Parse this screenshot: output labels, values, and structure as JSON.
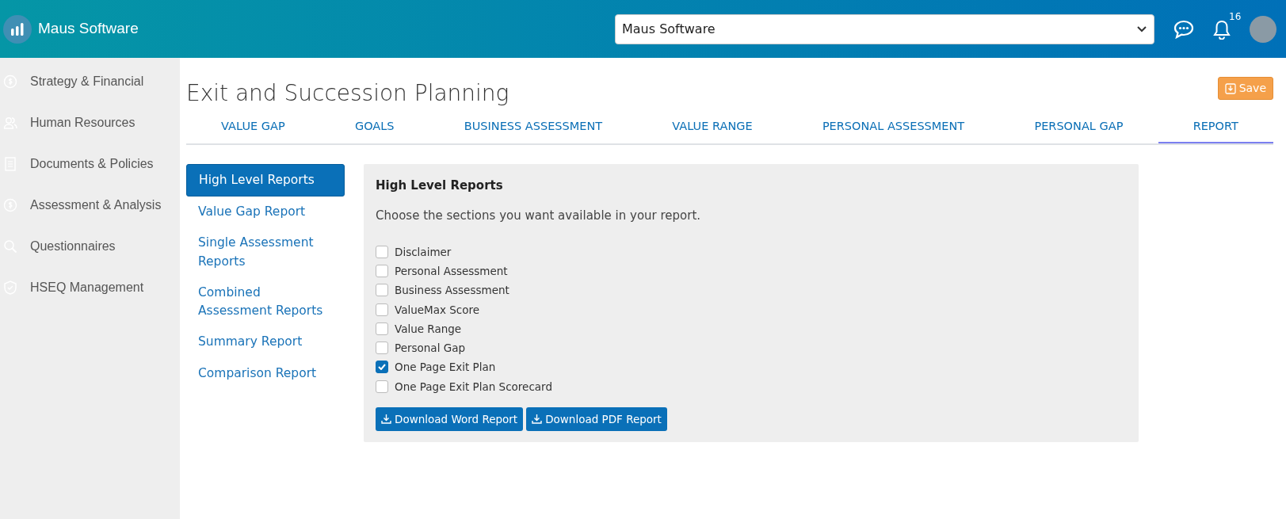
{
  "header": {
    "brand": "Maus Software",
    "company_select": {
      "value": "Maus Software"
    },
    "notifications": {
      "count": "16"
    }
  },
  "sidebar": {
    "items": [
      {
        "label": "Strategy & Financial",
        "kind": "dollar"
      },
      {
        "label": "Human Resources",
        "kind": "people"
      },
      {
        "label": "Documents & Policies",
        "kind": "document"
      },
      {
        "label": "Assessment & Analysis",
        "kind": "dollar"
      },
      {
        "label": "Questionnaires",
        "kind": "search"
      },
      {
        "label": "HSEQ Management",
        "kind": "shield"
      }
    ]
  },
  "page": {
    "title": "Exit and Succession Planning",
    "save_button": "Save"
  },
  "tabs": [
    {
      "label": "VALUE GAP",
      "selected": false
    },
    {
      "label": "GOALS",
      "selected": false
    },
    {
      "label": "BUSINESS ASSESSMENT",
      "selected": false
    },
    {
      "label": "VALUE RANGE",
      "selected": false
    },
    {
      "label": "PERSONAL ASSESSMENT",
      "selected": false
    },
    {
      "label": "PERSONAL GAP",
      "selected": false
    },
    {
      "label": "REPORT",
      "selected": true
    }
  ],
  "report_nav": [
    {
      "label": "High Level Reports",
      "selected": true
    },
    {
      "label": "Value Gap Report",
      "selected": false
    },
    {
      "label": "Single Assessment Reports",
      "selected": false
    },
    {
      "label": "Combined Assessment Reports",
      "selected": false
    },
    {
      "label": "Summary Report",
      "selected": false
    },
    {
      "label": "Comparison Report",
      "selected": false
    }
  ],
  "panel": {
    "title": "High Level Reports",
    "description": "Choose the sections you want available in your report.",
    "sections": [
      {
        "label": "Disclaimer",
        "checked": false
      },
      {
        "label": "Personal Assessment",
        "checked": false
      },
      {
        "label": "Business Assessment",
        "checked": false
      },
      {
        "label": "ValueMax Score",
        "checked": false
      },
      {
        "label": "Value Range",
        "checked": false
      },
      {
        "label": "Personal Gap",
        "checked": false
      },
      {
        "label": "One Page Exit Plan",
        "checked": true
      },
      {
        "label": "One Page Exit Plan Scorecard",
        "checked": false
      }
    ],
    "buttons": [
      "Download Word Report",
      "Download PDF Report"
    ]
  }
}
